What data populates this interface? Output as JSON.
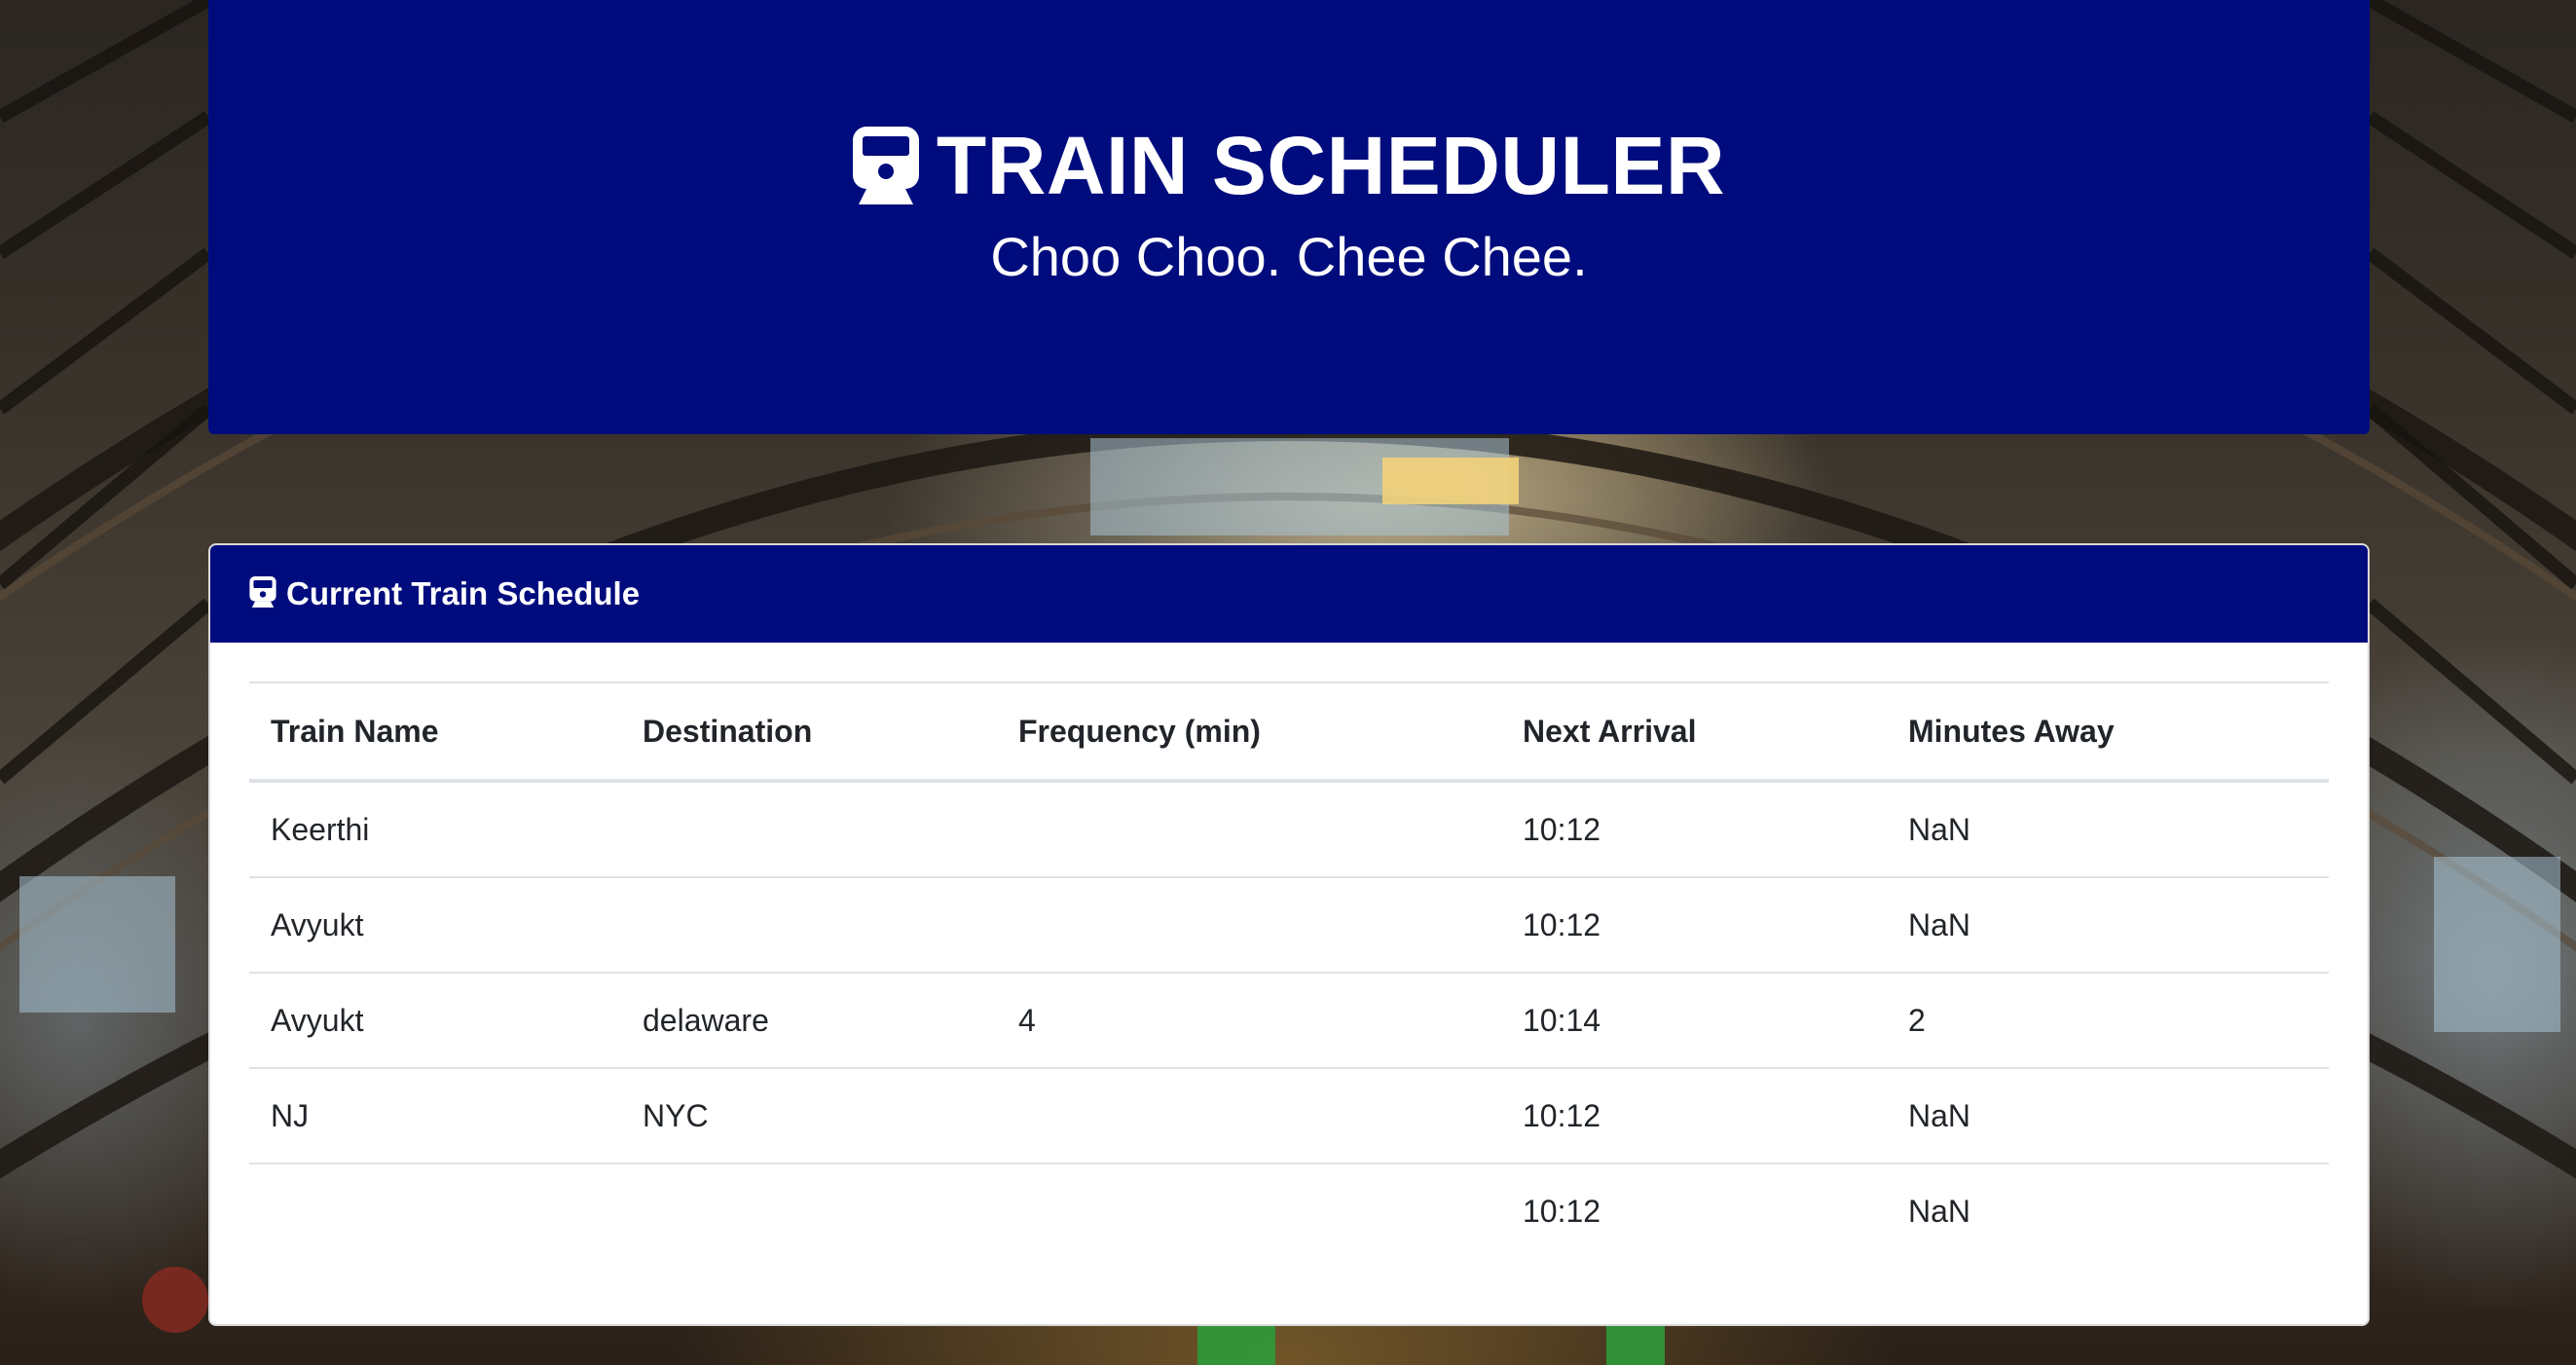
{
  "header": {
    "title": "TRAIN SCHEDULER",
    "subtitle": "Choo Choo. Chee Chee.",
    "icon": "train-icon"
  },
  "schedule": {
    "heading": "Current Train Schedule",
    "icon": "train-icon",
    "columns": [
      "Train Name",
      "Destination",
      "Frequency (min)",
      "Next Arrival",
      "Minutes Away"
    ],
    "rows": [
      {
        "name": "Keerthi",
        "destination": "",
        "frequency": "",
        "next_arrival": "10:12",
        "minutes_away": "NaN"
      },
      {
        "name": "Avyukt",
        "destination": "",
        "frequency": "",
        "next_arrival": "10:12",
        "minutes_away": "NaN"
      },
      {
        "name": "Avyukt",
        "destination": "delaware",
        "frequency": "4",
        "next_arrival": "10:14",
        "minutes_away": "2"
      },
      {
        "name": "NJ",
        "destination": "NYC",
        "frequency": "",
        "next_arrival": "10:12",
        "minutes_away": "NaN"
      },
      {
        "name": "",
        "destination": "",
        "frequency": "",
        "next_arrival": "10:12",
        "minutes_away": "NaN"
      }
    ]
  },
  "colors": {
    "primary": "#000c7d",
    "card_bg": "#ffffff",
    "text": "#212529",
    "border": "#dee2e6"
  }
}
